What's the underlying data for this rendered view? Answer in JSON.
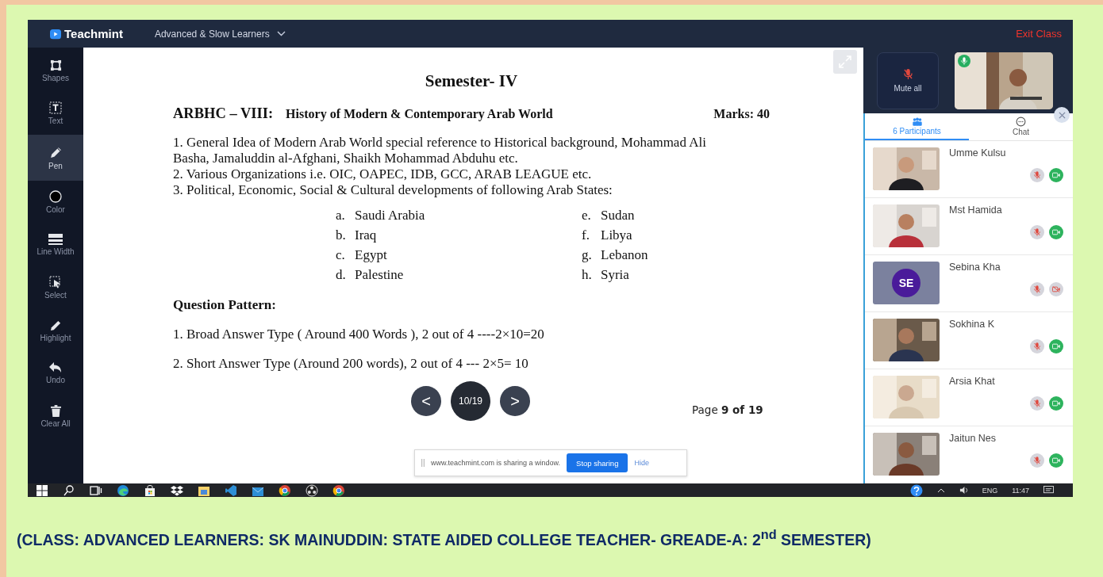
{
  "app": {
    "logo": "Teachmint",
    "class_name": "Advanced & Slow Learners",
    "exit": "Exit Class"
  },
  "tools": [
    {
      "label": "Shapes",
      "kind": "shapes",
      "selected": false
    },
    {
      "label": "Text",
      "kind": "text",
      "selected": false
    },
    {
      "label": "Pen",
      "kind": "pen",
      "selected": true
    },
    {
      "label": "Color",
      "kind": "color",
      "selected": false
    },
    {
      "label": "Line Width",
      "kind": "line",
      "selected": false
    },
    {
      "label": "Select",
      "kind": "select",
      "selected": false
    },
    {
      "label": "Highlight",
      "kind": "highlight",
      "selected": false
    },
    {
      "label": "Undo",
      "kind": "undo",
      "selected": false
    },
    {
      "label": "Clear All",
      "kind": "clear",
      "selected": false
    }
  ],
  "document": {
    "title": "Semester- IV",
    "code": "ARBHC – VIII:",
    "course": "History of Modern & Contemporary Arab World",
    "marks": "Marks: 40",
    "items": [
      "1. General Idea of Modern Arab World special reference to Historical background, Mohammad Ali Basha, Jamaluddin al-Afghani, Shaikh Mohammad Abduhu etc.",
      "2. Various Organizations i.e. OIC, OAPEC, IDB, GCC, ARAB LEAGUE etc.",
      "3. Political, Economic, Social & Cultural developments of following Arab States:"
    ],
    "states": [
      {
        "letter": "a.",
        "name": "Saudi Arabia"
      },
      {
        "letter": "e.",
        "name": "Sudan"
      },
      {
        "letter": "b.",
        "name": "Iraq"
      },
      {
        "letter": "f.",
        "name": "Libya"
      },
      {
        "letter": "c.",
        "name": "Egypt"
      },
      {
        "letter": "g.",
        "name": "Lebanon"
      },
      {
        "letter": "d.",
        "name": "Palestine"
      },
      {
        "letter": "h.",
        "name": "Syria"
      }
    ],
    "pattern_title": "Question Pattern:",
    "pattern": [
      "1. Broad Answer Type ( Around 400 Words ), 2 out of 4 ----2×10=20",
      "2. Short Answer Type (Around 200 words), 2 out of 4 --- 2×5= 10"
    ],
    "page_label": "Page **9 of 19**"
  },
  "pager": {
    "prev": "<",
    "counter": "10/19",
    "next": ">"
  },
  "share_bar": {
    "message": "www.teachmint.com is sharing a window.",
    "stop": "Stop sharing",
    "hide": "Hide"
  },
  "panel": {
    "mute_all": "Mute all",
    "self_mic_on": true,
    "tabs": [
      {
        "label": "6 Participants",
        "kind": "people",
        "selected": true
      },
      {
        "label": "Chat",
        "kind": "chat",
        "selected": false
      }
    ],
    "participants": [
      {
        "name": "Umme Kulsu",
        "kind": "video",
        "mic_on": false,
        "camera_on": true
      },
      {
        "name": "Mst Hamida",
        "kind": "video",
        "mic_on": false,
        "camera_on": true
      },
      {
        "name": "Sebina Kha",
        "kind": "avatar",
        "initials": "SE",
        "mic_on": false,
        "camera_on": false
      },
      {
        "name": "Sokhina K",
        "kind": "video",
        "mic_on": false,
        "camera_on": true
      },
      {
        "name": "Arsia Khat",
        "kind": "video",
        "mic_on": false,
        "camera_on": true
      },
      {
        "name": "Jaitun Nes",
        "kind": "video",
        "mic_on": false,
        "camera_on": true
      }
    ]
  },
  "taskbar": {
    "language": "ENG",
    "time": "11:47"
  },
  "caption": "(CLASS: ADVANCED LEARNERS: SK MAINUDDIN: STATE AIDED COLLEGE TEACHER- GREADE-A: 2$^{nd}$ SEMESTER)"
}
